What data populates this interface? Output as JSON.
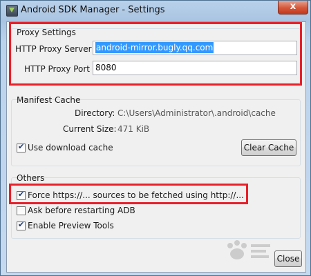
{
  "window": {
    "title": "Android SDK Manager - Settings",
    "close_glyph": "x",
    "icon": "android-sdk-icon"
  },
  "proxy": {
    "group_title": "Proxy Settings",
    "server_label": "HTTP Proxy Server",
    "server_value": "android-mirror.bugly.qq.com",
    "port_label": "HTTP Proxy Port",
    "port_value": "8080"
  },
  "manifest": {
    "group_title": "Manifest Cache",
    "directory_label": "Directory:",
    "directory_value": "C:\\Users\\Administrator\\.android\\cache",
    "size_label": "Current Size:",
    "size_value": "471 KiB",
    "use_cache_label": "Use download cache",
    "use_cache_checked": true,
    "clear_button": "Clear Cache"
  },
  "others": {
    "group_title": "Others",
    "force_http_label": "Force https://... sources to be fetched using http://...",
    "force_http_checked": true,
    "ask_restart_label": "Ask before restarting ADB",
    "ask_restart_checked": false,
    "preview_tools_label": "Enable Preview Tools",
    "preview_tools_checked": true
  },
  "close_button": "Close",
  "colors": {
    "highlight": "#e8202a",
    "selection": "#3399ff"
  }
}
